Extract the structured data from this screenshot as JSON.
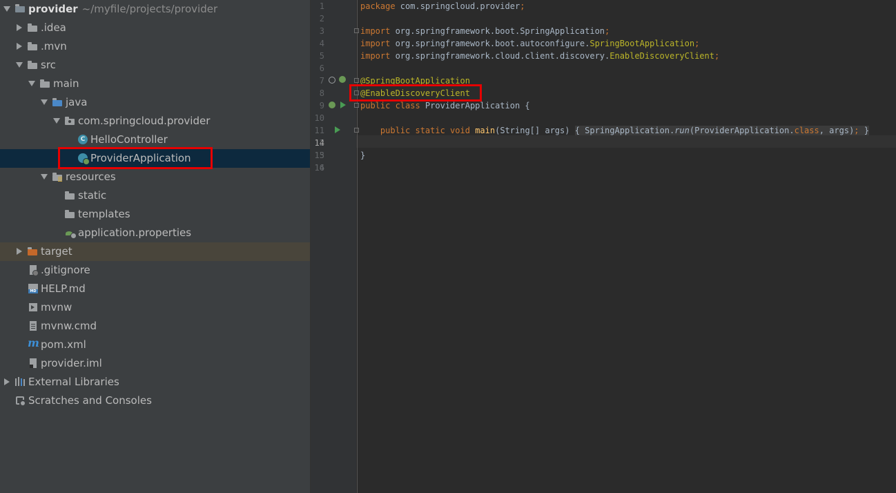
{
  "project_tree": {
    "root": {
      "name": "provider",
      "path": "~/myfile/projects/provider"
    },
    "items": [
      {
        "label": ".idea"
      },
      {
        "label": ".mvn"
      },
      {
        "label": "src"
      },
      {
        "label": "main"
      },
      {
        "label": "java"
      },
      {
        "label": "com.springcloud.provider"
      },
      {
        "label": "HelloController"
      },
      {
        "label": "ProviderApplication"
      },
      {
        "label": "resources"
      },
      {
        "label": "static"
      },
      {
        "label": "templates"
      },
      {
        "label": "application.properties"
      },
      {
        "label": "target"
      },
      {
        "label": ".gitignore"
      },
      {
        "label": "HELP.md"
      },
      {
        "label": "mvnw"
      },
      {
        "label": "mvnw.cmd"
      },
      {
        "label": "pom.xml"
      },
      {
        "label": "provider.iml"
      },
      {
        "label": "External Libraries"
      },
      {
        "label": "Scratches and Consoles"
      }
    ],
    "class_icon_letter": "C",
    "md_icon_text": "MD",
    "maven_icon_letter": "m"
  },
  "editor": {
    "line_numbers": [
      "1",
      "2",
      "3",
      "4",
      "5",
      "6",
      "7",
      "8",
      "9",
      "10",
      "11",
      "12",
      "13",
      "14",
      "15",
      "16"
    ],
    "current_line": "14",
    "code": {
      "l1_kw": "package",
      "l1_rest": " com.springcloud.provider",
      "semicolon": ";",
      "import_kw": "import",
      "l3_pkg": " org.springframework.boot.SpringApplication",
      "l4_pkg": " org.springframework.boot.autoconfigure.",
      "l4_cls": "SpringBootApplication",
      "l5_pkg": " org.springframework.cloud.client.discovery.",
      "l5_cls": "EnableDiscoveryClient",
      "l7": "@SpringBootApplication",
      "l8": "@EnableDiscoveryClient",
      "l9_kw": "public class",
      "l9_rest": " ProviderApplication {",
      "l11_kw": "public static void",
      "l11_fn": "main",
      "l11_args": "(String[] args) ",
      "l11_body_open": "{ ",
      "l11_call": "SpringApplication.",
      "l11_run": "run",
      "l11_args2": "(ProviderApplication.",
      "l11_class": "class",
      "l11_end": ", args)",
      "l11_close": " }",
      "l15": "}"
    }
  },
  "colors": {
    "highlight_box": "#e60000",
    "selection": "#0d293e",
    "keyword": "#cc7832",
    "annotation": "#bbb529",
    "method": "#ffc66d"
  }
}
